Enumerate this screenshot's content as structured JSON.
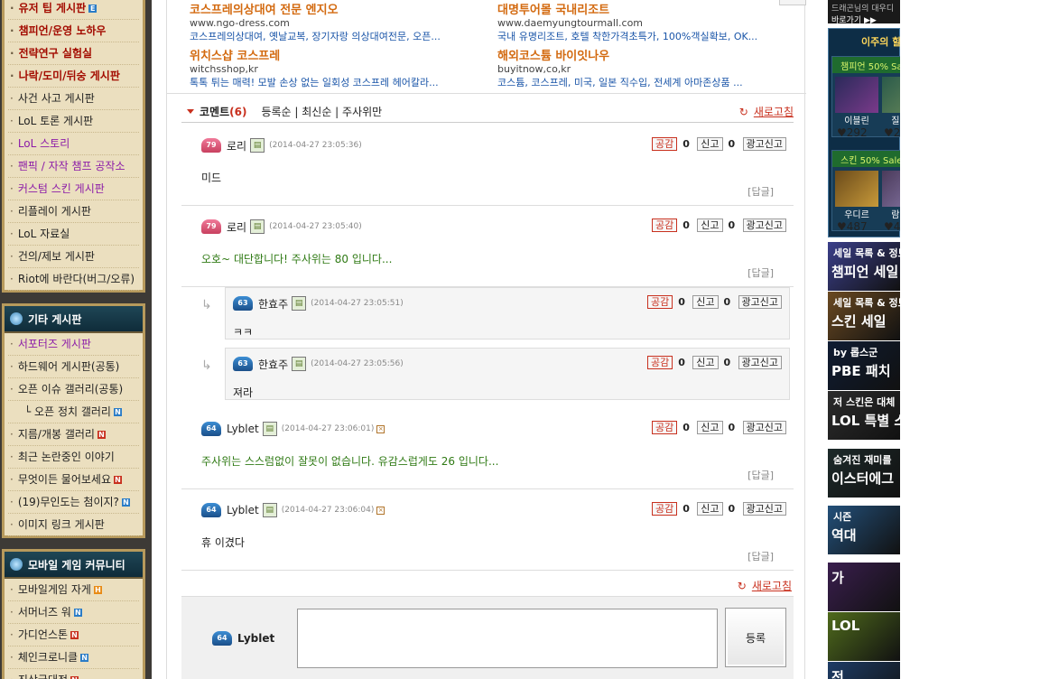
{
  "sidebar": {
    "panel1_items": [
      {
        "label": "유저 팁 게시판",
        "style": "red",
        "badge": "E"
      },
      {
        "label": "챔피언/운영 노하우",
        "style": "red"
      },
      {
        "label": "전략연구 실험실",
        "style": "red"
      },
      {
        "label": "나락/도미/뒤숭 게시판",
        "style": "red"
      },
      {
        "label": "사건 사고 게시판",
        "style": ""
      },
      {
        "label": "LoL 토론 게시판",
        "style": ""
      },
      {
        "label": "LoL 스토리",
        "style": "purple"
      },
      {
        "label": "팬픽 / 자작 챔프 공작소",
        "style": "purple"
      },
      {
        "label": "커스텀 스킨 게시판",
        "style": "purple"
      },
      {
        "label": "리플레이 게시판",
        "style": ""
      },
      {
        "label": "LoL 자료실",
        "style": ""
      },
      {
        "label": "건의/제보 게시판",
        "style": ""
      },
      {
        "label": "Riot에 바란다(버그/오류)",
        "style": ""
      }
    ],
    "panel2_title": "기타 게시판",
    "panel2_items": [
      {
        "label": "서포터즈 게시판",
        "style": "purple"
      },
      {
        "label": "하드웨어 게시판(공통)",
        "style": ""
      },
      {
        "label": "오픈 이슈 갤러리(공통)",
        "style": ""
      },
      {
        "label": "오픈 정치 갤러리",
        "style": "sub",
        "badge": "N"
      },
      {
        "label": "지름/개봉 갤러리",
        "style": "",
        "badge": "N"
      },
      {
        "label": "최근 논란중인 이야기",
        "style": ""
      },
      {
        "label": "무엇이든 물어보세요",
        "style": "",
        "badge": "N"
      },
      {
        "label": "(19)무인도는 첨이지?",
        "style": "",
        "badge": "N"
      },
      {
        "label": "이미지 링크 게시판",
        "style": ""
      }
    ],
    "panel3_title": "모바일 게임 커뮤니티",
    "panel3_items": [
      {
        "label": "모바일게임 자게",
        "style": "",
        "badge": "H"
      },
      {
        "label": "서머너즈 워",
        "style": "",
        "badge": "N"
      },
      {
        "label": "가디언스톤",
        "style": "",
        "badge": "N"
      },
      {
        "label": "체인크로니클",
        "style": "",
        "badge": "N"
      },
      {
        "label": "진상국대전",
        "style": "",
        "badge": "N"
      }
    ]
  },
  "ads": [
    {
      "title": "코스프레의상대여 전문 엔지오",
      "url": "www.ngo-dress.com",
      "desc": "코스프레의상대여, 옛날교복, 장기자랑 의상대여전문, 오픈..."
    },
    {
      "title": "대명투어몰 국내리조트",
      "url": "www.daemyungtourmall.com",
      "desc": "국내 유명리조트, 호텔 착한가격초특가, 100%객실확보, OK..."
    },
    {
      "title": "위치스샵 코스프레",
      "url": "witchsshop,kr",
      "desc": "톡톡 튀는 매력! 모발 손상 없는 일회성 코스프레 헤어칼라..."
    },
    {
      "title": "해외코스튬 바이잇나우",
      "url": "buyitnow,co,kr",
      "desc": "코스튬, 코스프레, 미국, 일본 직수입, 전세계 아마존상품 ..."
    }
  ],
  "comments_header": {
    "title": "코멘트",
    "count": "(6)",
    "sort": "등록순 | 최신순 | 주사위만",
    "refresh": "새로고침"
  },
  "buttons": {
    "like": "공감",
    "report": "신고",
    "ad_report": "광고신고",
    "reply": "[답글]"
  },
  "comments": [
    {
      "level": "79",
      "user": "로리",
      "time": "(2014-04-27 23:05:36)",
      "likes": "0",
      "reports": "0",
      "body": "미드"
    },
    {
      "level": "79",
      "user": "로리",
      "time": "(2014-04-27 23:05:40)",
      "likes": "0",
      "reports": "0",
      "body": "오호~ 대단합니다! 주사위는 80 입니다..."
    },
    {
      "level": "63",
      "user": "한효주",
      "time": "(2014-04-27 23:05:51)",
      "likes": "0",
      "reports": "0",
      "body": "ㅋㅋ"
    },
    {
      "level": "63",
      "user": "한효주",
      "time": "(2014-04-27 23:05:56)",
      "likes": "0",
      "reports": "0",
      "body": "져라"
    },
    {
      "level": "64",
      "user": "Lyblet",
      "time": "(2014-04-27 23:06:01)",
      "likes": "0",
      "reports": "0",
      "body": "주사위는 스스럼없이 잘못이 없습니다. 유감스럽게도 26 입니다..."
    },
    {
      "level": "64",
      "user": "Lyblet",
      "time": "(2014-04-27 23:06:04)",
      "likes": "0",
      "reports": "0",
      "body": "휴 이겼다"
    }
  ],
  "write": {
    "level": "64",
    "user": "Lyblet",
    "submit": "등록",
    "refresh": "새로고침"
  },
  "right": {
    "top_line1": "드래곤님의 대우디",
    "top_line2": "바로가기 ▶▶",
    "panel_title": "이주의 할인",
    "sale1_title": "챔피언 50% Sale",
    "sale2_title": "스킨 50% Sale",
    "champs1": [
      {
        "name": "이블린",
        "price": "292"
      },
      {
        "name": "질리언",
        "price": "292"
      }
    ],
    "champs2": [
      {
        "name": "우디르",
        "price": "487"
      },
      {
        "name": "람머스",
        "price": "487"
      }
    ],
    "banners": [
      {
        "l1": "세일 목록 & 정보",
        "l2": "챔피언 세일",
        "color": "#3b3f8a"
      },
      {
        "l1": "세일 목록 & 정보",
        "l2": "스킨 세일",
        "color": "#6b4a22"
      },
      {
        "l1": "by 롭스군",
        "l2": "PBE 패치",
        "color": "#0f1c33"
      },
      {
        "l1": "저 스킨은 대체",
        "l2": "LOL 특별 스킨",
        "color": "#2c2c2c"
      },
      {
        "l1": "숨겨진 재미를",
        "l2": "이스터에그",
        "color": "#1d2a2a"
      },
      {
        "l1": "시즌",
        "l2": "역대",
        "color": "#23507a"
      },
      {
        "l1": "",
        "l2": "가",
        "color": "#3a1e4e"
      },
      {
        "l1": "",
        "l2": "LOL",
        "color": "#4f6a1c"
      },
      {
        "l1": "",
        "l2": "전",
        "color": "#1e3d66"
      }
    ]
  }
}
